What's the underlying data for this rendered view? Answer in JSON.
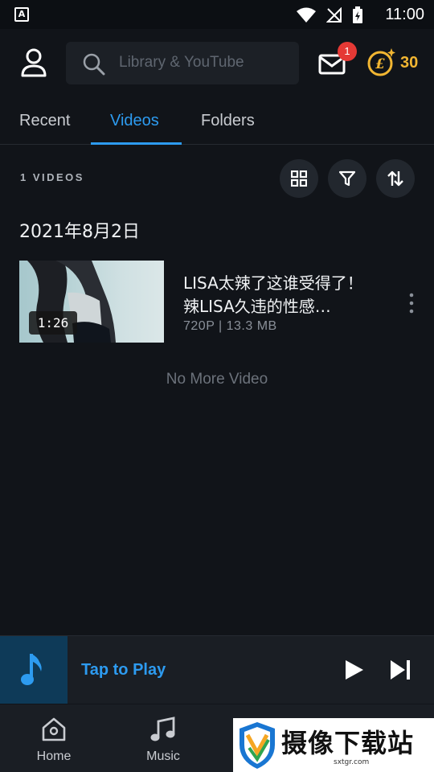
{
  "status_bar": {
    "time": "11:00",
    "app_letter": "A"
  },
  "search": {
    "placeholder": "Library & YouTube"
  },
  "mail": {
    "badge": "1"
  },
  "coins": {
    "count": "30"
  },
  "tabs": [
    {
      "label": "Recent",
      "active": false
    },
    {
      "label": "Videos",
      "active": true
    },
    {
      "label": "Folders",
      "active": false
    }
  ],
  "summary": {
    "count_label": "1 VIDEOS"
  },
  "groups": [
    {
      "date": "2021年8月2日",
      "videos": [
        {
          "title": "LISA太辣了这谁受得了！辣LISA久违的性感…",
          "duration": "1:26",
          "meta": "720P | 13.3 MB"
        }
      ]
    }
  ],
  "footer_text": "No More Video",
  "mini_player": {
    "label": "Tap to Play"
  },
  "bottom_nav": [
    {
      "label": "Home",
      "icon": "home-icon"
    },
    {
      "label": "Music",
      "icon": "music-note-icon"
    }
  ],
  "watermark": {
    "text": "摄像下载站",
    "url": "sxtgr.com"
  },
  "colors": {
    "accent": "#2d9bf0",
    "background": "#111419",
    "coin": "#f2b632",
    "badge": "#e53935"
  }
}
